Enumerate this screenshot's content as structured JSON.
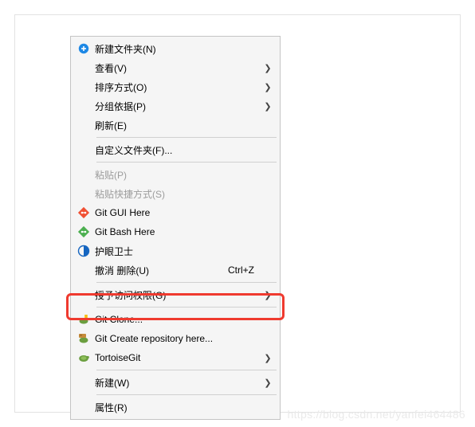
{
  "menu": {
    "groups": [
      [
        {
          "label": "新建文件夹(N)",
          "icon": "new-folder",
          "submenu": false,
          "enabled": true
        },
        {
          "label": "查看(V)",
          "icon": null,
          "submenu": true,
          "enabled": true
        },
        {
          "label": "排序方式(O)",
          "icon": null,
          "submenu": true,
          "enabled": true
        },
        {
          "label": "分组依据(P)",
          "icon": null,
          "submenu": true,
          "enabled": true
        },
        {
          "label": "刷新(E)",
          "icon": null,
          "submenu": false,
          "enabled": true
        }
      ],
      [
        {
          "label": "自定义文件夹(F)...",
          "icon": null,
          "submenu": false,
          "enabled": true
        }
      ],
      [
        {
          "label": "粘贴(P)",
          "icon": null,
          "submenu": false,
          "enabled": false
        },
        {
          "label": "粘贴快捷方式(S)",
          "icon": null,
          "submenu": false,
          "enabled": false
        },
        {
          "label": "Git GUI Here",
          "icon": "git-gui",
          "submenu": false,
          "enabled": true
        },
        {
          "label": "Git Bash Here",
          "icon": "git-bash",
          "submenu": false,
          "enabled": true
        },
        {
          "label": "护眼卫士",
          "icon": "eye-guard",
          "submenu": false,
          "enabled": true
        },
        {
          "label": "撤消 删除(U)",
          "icon": null,
          "submenu": false,
          "enabled": true,
          "shortcut": "Ctrl+Z"
        }
      ],
      [
        {
          "label": "授予访问权限(G)",
          "icon": null,
          "submenu": true,
          "enabled": true
        }
      ],
      [
        {
          "label": "Git Clone...",
          "icon": "tortoise-clone",
          "submenu": false,
          "enabled": true,
          "highlighted": true
        },
        {
          "label": "Git Create repository here...",
          "icon": "tortoise-create",
          "submenu": false,
          "enabled": true
        },
        {
          "label": "TortoiseGit",
          "icon": "tortoise",
          "submenu": true,
          "enabled": true
        }
      ],
      [
        {
          "label": "新建(W)",
          "icon": null,
          "submenu": true,
          "enabled": true
        }
      ],
      [
        {
          "label": "属性(R)",
          "icon": null,
          "submenu": false,
          "enabled": true
        }
      ]
    ]
  },
  "icons": {
    "new-folder": "new-folder-icon",
    "git-gui": "git-gui-icon",
    "git-bash": "git-bash-icon",
    "eye-guard": "eye-guard-icon",
    "tortoise-clone": "tortoise-clone-icon",
    "tortoise-create": "tortoise-create-icon",
    "tortoise": "tortoise-icon"
  },
  "watermark": "https://blog.csdn.net/yanfei464486"
}
